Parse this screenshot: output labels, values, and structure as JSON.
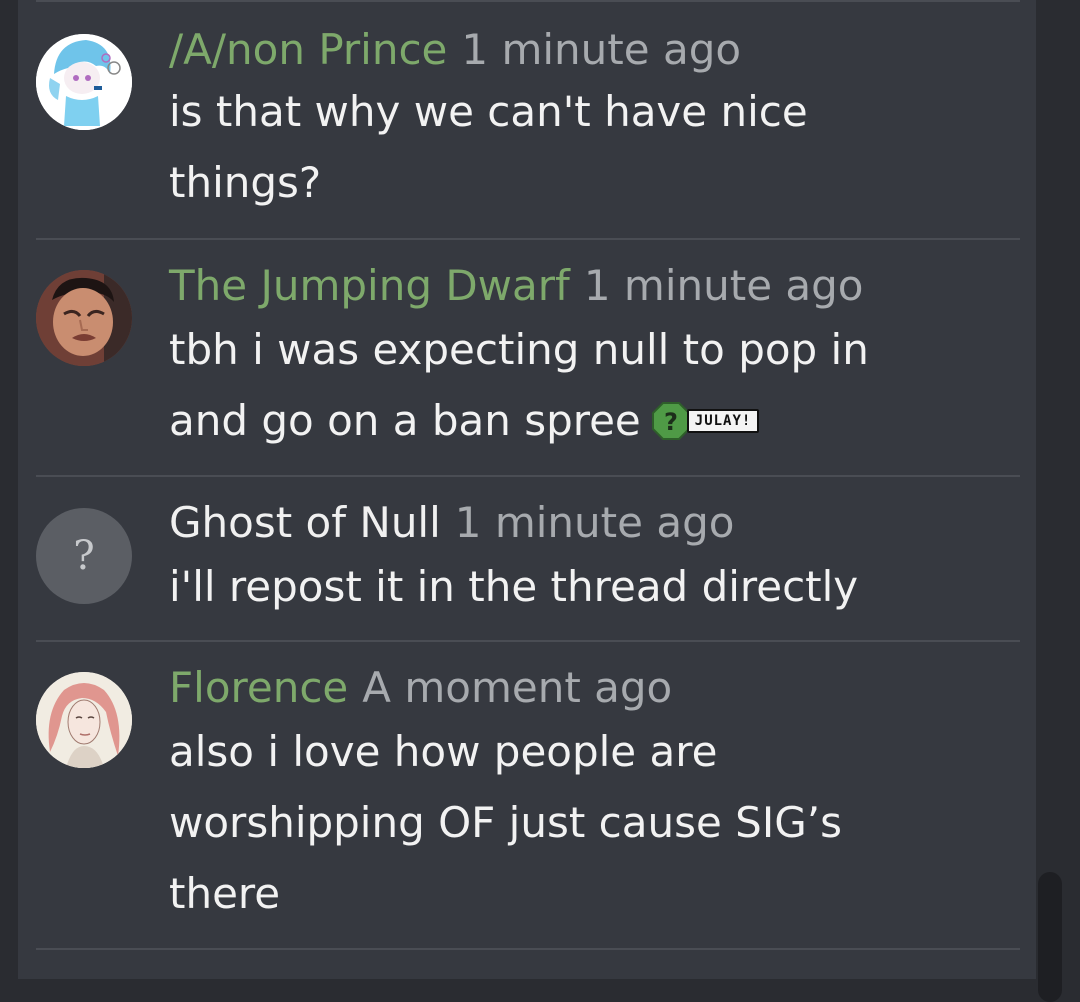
{
  "messages": [
    {
      "author": "/A/non Prince",
      "time": "1 minute ago",
      "text": "is that why we can't have nice things?"
    },
    {
      "author": "The Jumping Dwarf",
      "time": "1 minute ago",
      "text": "tbh i was expecting null to pop in and go on a ban spree",
      "emoji": {
        "icon": "question-mark-emoji-icon",
        "symbol": "?"
      },
      "sticker": {
        "label": "JULAY!"
      }
    },
    {
      "author": "Ghost of Null",
      "time": "1 minute ago",
      "text": "i'll repost it in the thread directly",
      "avatar_placeholder": "?"
    },
    {
      "author": "Florence",
      "time": "A moment ago",
      "text": "also i love how people are worshipping OF just cause SIG’s there"
    }
  ],
  "colors": {
    "background": "#363940",
    "author_highlight": "#7ea96b",
    "timestamp": "#a7aaae",
    "message_text": "#f2f2f2"
  }
}
